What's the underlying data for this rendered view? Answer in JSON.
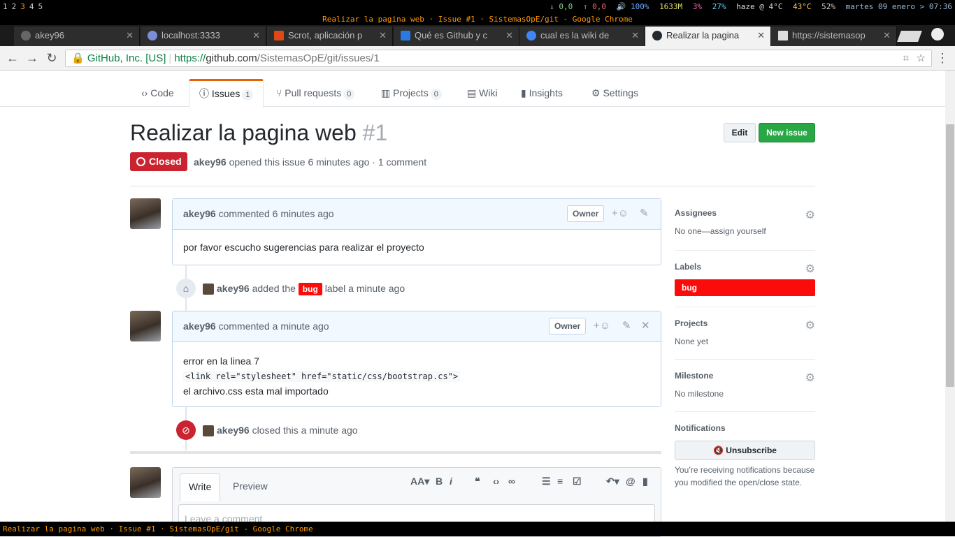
{
  "system_bar": {
    "workspaces": [
      "1",
      "2",
      "3",
      "4",
      "5"
    ],
    "stats": [
      "↓ 0,0",
      "↑ 0,0",
      "🔊 100%",
      "1633M",
      "3%",
      "27%",
      "haze @ 4°C",
      "43°C",
      "52%",
      "martes 09 enero > 07:36"
    ]
  },
  "window_title": "Realizar la pagina web · Issue #1 · SistemasOpE/git - Google Chrome",
  "browser_tabs": [
    {
      "label": "akey96"
    },
    {
      "label": "localhost:3333"
    },
    {
      "label": "Scrot, aplicación p"
    },
    {
      "label": "Qué es Github y c"
    },
    {
      "label": "cual es la wiki de"
    },
    {
      "label": "Realizar la pagina"
    },
    {
      "label": "https://sistemasop"
    }
  ],
  "address_bar": {
    "secure_label": "GitHub, Inc. [US]",
    "url_scheme": "https://",
    "url_host": "github.com",
    "url_path": "/SistemasOpE/git/issues/1"
  },
  "repo_nav": {
    "code": "Code",
    "issues": "Issues",
    "issues_count": "1",
    "pulls": "Pull requests",
    "pulls_count": "0",
    "projects": "Projects",
    "projects_count": "0",
    "wiki": "Wiki",
    "insights": "Insights",
    "settings": "Settings"
  },
  "issue": {
    "title": "Realizar la pagina web",
    "number": "#1",
    "edit_label": "Edit",
    "new_issue_label": "New issue",
    "state": "Closed",
    "author": "akey96",
    "meta_text": "opened this issue 6 minutes ago · 1 comment"
  },
  "comments": [
    {
      "author": "akey96",
      "when": "commented 6 minutes ago",
      "role": "Owner",
      "body": "por favor escucho sugerencias para realizar el proyecto"
    },
    {
      "author": "akey96",
      "when": "commented a minute ago",
      "role": "Owner",
      "body_line1": "error en la linea 7",
      "body_code": "<link rel=\"stylesheet\" href=\"static/css/bootstrap.cs\">",
      "body_line2": "el archivo.css esta mal importado"
    }
  ],
  "events": {
    "label_event": {
      "author": "akey96",
      "pre": "added the",
      "label": "bug",
      "post": "label a minute ago"
    },
    "closed_event": {
      "author": "akey96",
      "text": "closed this a minute ago"
    }
  },
  "new_comment": {
    "write_tab": "Write",
    "preview_tab": "Preview",
    "placeholder": "Leave a comment"
  },
  "sidebar": {
    "assignees_title": "Assignees",
    "assignees_value": "No one—assign yourself",
    "labels_title": "Labels",
    "label_bug": "bug",
    "projects_title": "Projects",
    "projects_value": "None yet",
    "milestone_title": "Milestone",
    "milestone_value": "No milestone",
    "notifications_title": "Notifications",
    "unsubscribe_label": "Unsubscribe",
    "notifications_text": "You’re receiving notifications because you modified the open/close state."
  },
  "colors": {
    "closed_red": "#cb2431",
    "bug_label": "#fc0b0b",
    "new_issue_green": "#28a745",
    "active_tab_accent": "#e36209"
  },
  "status_bar_text": "Realizar la pagina web · Issue #1 · SistemasOpE/git - Google Chrome"
}
